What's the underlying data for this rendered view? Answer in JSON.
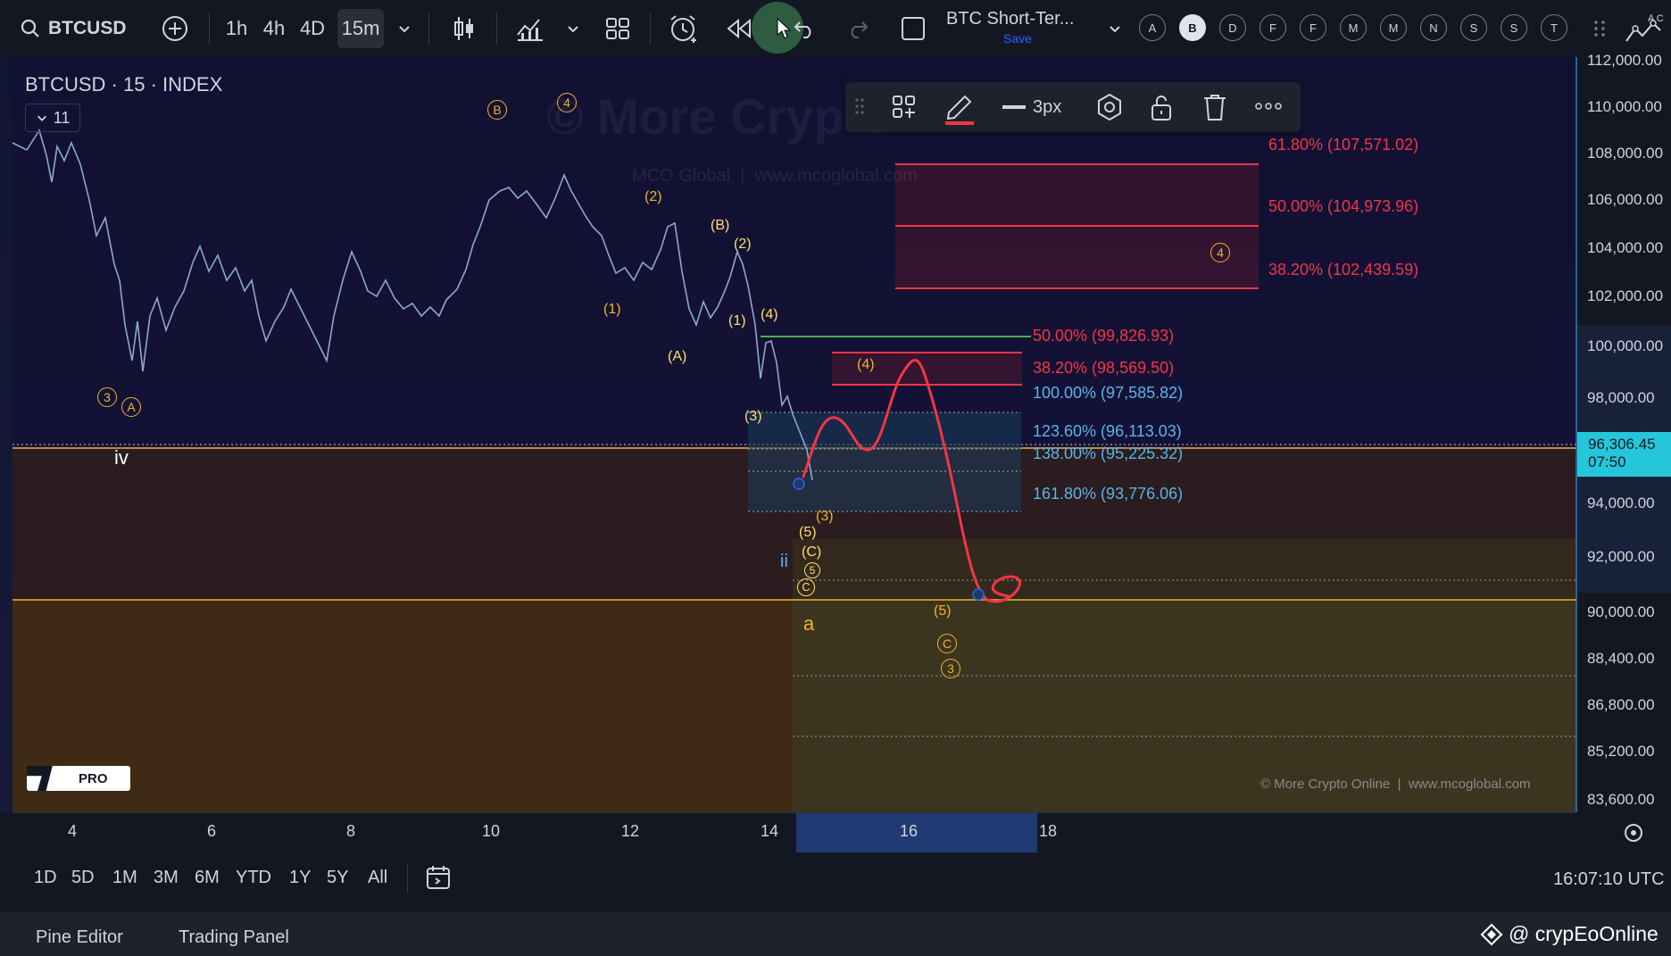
{
  "topbar": {
    "symbol": "BTCUSD",
    "intervals": [
      "1h",
      "4h",
      "4D",
      "15m"
    ],
    "active_interval": "15m",
    "layout_name": "BTC Short-Ter...",
    "save_label": "Save",
    "alphabet": [
      "A",
      "B",
      "D",
      "F",
      "F",
      "M",
      "M",
      "N",
      "S",
      "S",
      "T"
    ],
    "active_letter": "B"
  },
  "chart": {
    "legend_title": "BTCUSD · 15 · INDEX",
    "indicator_count": "11",
    "watermark": "© More Crypto",
    "watermark_sub": "MCO Global  |  www.mcoglobal.com",
    "copyright": "© More Crypto Online  |  www.mcoglobal.com",
    "price_axis": [
      "112,000.00",
      "110,000.00",
      "108,000.00",
      "106,000.00",
      "104,000.00",
      "102,000.00",
      "100,000.00",
      "98,000.00",
      "94,000.00",
      "92,000.00",
      "90,000.00",
      "88,400.00",
      "86,800.00",
      "85,200.00",
      "83,600.00"
    ],
    "last_price": "96,306.45",
    "countdown": "07:50",
    "time_axis": [
      "4",
      "6",
      "8",
      "10",
      "12",
      "14",
      "16",
      "18"
    ],
    "fib_labels": {
      "f618_top": "61.80% (107,571.02)",
      "f50_top": "50.00% (104,973.96)",
      "f382_top": "38.20% (102,439.59)",
      "f50_mid": "50.00% (99,826.93)",
      "f382_mid": "38.20% (98,569.50)",
      "f100": "100.00% (97,585.82)",
      "f1236": "123.60% (96,113.03)",
      "f138": "138.00% (95,225.32)",
      "f1618": "161.80% (93,776.06)"
    },
    "waves": {
      "w3c": "3",
      "wAc": "A",
      "wBc": "B",
      "w4c": "4",
      "iv": "iv",
      "w2a": "(2)",
      "wB": "(B)",
      "w2b": "(2)",
      "w1a": "(1)",
      "wA": "(A)",
      "w1b": "(1)",
      "w4": "(4)",
      "w3": "(3)",
      "w3b": "(3)",
      "w5": "(5)",
      "wC": "(C)",
      "w5c": "5",
      "wCc": "C",
      "ii": "ii",
      "a": "a",
      "box4": "(4)",
      "box4c": "4",
      "w5r": "(5)",
      "wCr": "C",
      "w3r": "3"
    },
    "brand": "PRO"
  },
  "drawing_toolbar": {
    "width_label": "3px"
  },
  "bottom": {
    "ranges": [
      "1D",
      "5D",
      "1M",
      "3M",
      "6M",
      "YTD",
      "1Y",
      "5Y",
      "All"
    ],
    "clock": "16:07:10 UTC"
  },
  "panels": {
    "pine": "Pine Editor",
    "trading": "Trading Panel",
    "handle": "@ crypEoOnline"
  }
}
